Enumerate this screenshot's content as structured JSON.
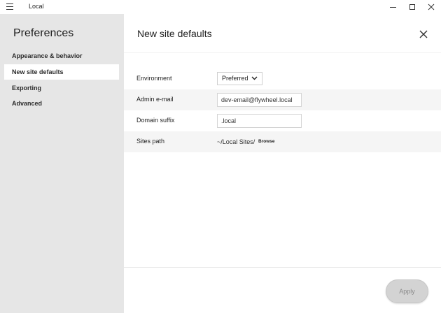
{
  "window": {
    "title": "Local",
    "menu_icon": "hamburger-icon",
    "controls": [
      "minimize-icon",
      "maximize-icon",
      "close-icon"
    ]
  },
  "sidebar": {
    "title": "Preferences",
    "items": [
      {
        "label": "Appearance & behavior",
        "active": false
      },
      {
        "label": "New site defaults",
        "active": true
      },
      {
        "label": "Exporting",
        "active": false
      },
      {
        "label": "Advanced",
        "active": false
      }
    ]
  },
  "main": {
    "title": "New site defaults",
    "fields": {
      "environment": {
        "label": "Environment",
        "value": "Preferred"
      },
      "admin_email": {
        "label": "Admin e-mail",
        "value": "dev-email@flywheel.local"
      },
      "domain_suffix": {
        "label": "Domain suffix",
        "value": ".local"
      },
      "sites_path": {
        "label": "Sites path",
        "value": "~/Local Sites/",
        "browse_label": "Browse"
      }
    },
    "apply_label": "Apply"
  },
  "colors": {
    "sidebar_bg": "#e6e6e6",
    "panel_bg": "#ffffff",
    "row_shade": "#f5f5f5",
    "apply_disabled": "#d3d3d3"
  }
}
